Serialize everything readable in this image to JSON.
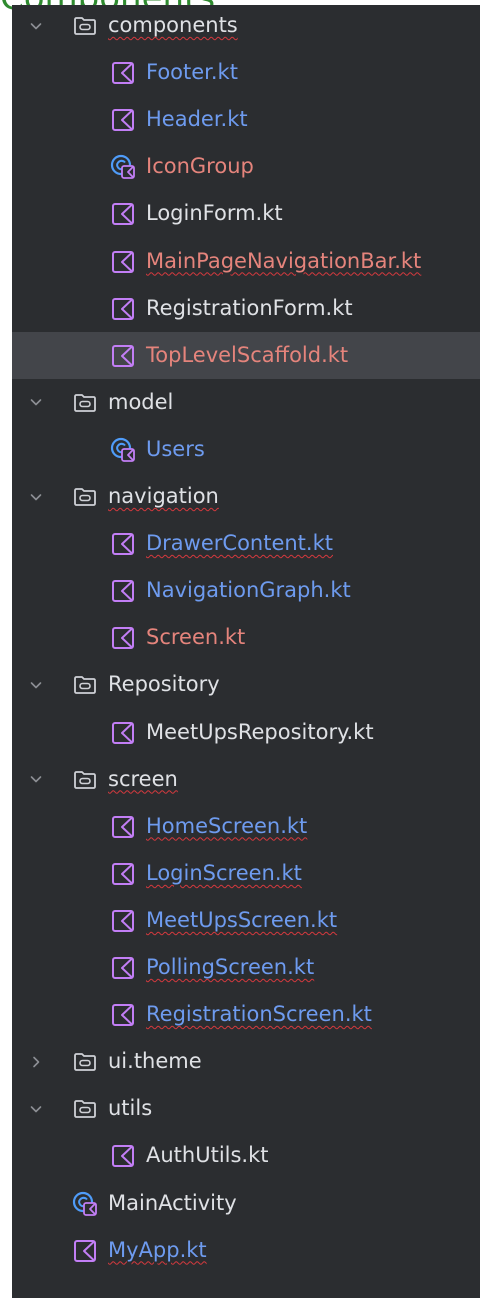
{
  "header": {
    "crop_title": "Components"
  },
  "colors": {
    "panel_bg": "#2b2d30",
    "selected_row_bg": "#43454a",
    "text_default": "#dfe1e5",
    "text_modified": "#6e9bef",
    "text_error": "#e5847c",
    "kotlin_file_icon": "#c27ef5",
    "kotlin_class_icon": "#4f9cf9",
    "squiggle": "#d5393e"
  },
  "tree": [
    {
      "name": "components",
      "kind": "folder",
      "expanded": true,
      "depth": 0,
      "color": "plain",
      "squiggle": true
    },
    {
      "name": "Footer.kt",
      "kind": "file",
      "depth": 1,
      "color": "modified",
      "squiggle": false
    },
    {
      "name": "Header.kt",
      "kind": "file",
      "depth": 1,
      "color": "modified",
      "squiggle": false
    },
    {
      "name": "IconGroup",
      "kind": "class",
      "depth": 1,
      "color": "error",
      "squiggle": false
    },
    {
      "name": "LoginForm.kt",
      "kind": "file",
      "depth": 1,
      "color": "plain",
      "squiggle": false
    },
    {
      "name": "MainPageNavigationBar.kt",
      "kind": "file",
      "depth": 1,
      "color": "error",
      "squiggle": true
    },
    {
      "name": "RegistrationForm.kt",
      "kind": "file",
      "depth": 1,
      "color": "plain",
      "squiggle": false
    },
    {
      "name": "TopLevelScaffold.kt",
      "kind": "file",
      "depth": 1,
      "color": "error",
      "squiggle": false,
      "selected": true
    },
    {
      "name": "model",
      "kind": "folder",
      "expanded": true,
      "depth": 0,
      "color": "plain",
      "squiggle": false
    },
    {
      "name": "Users",
      "kind": "class",
      "depth": 1,
      "color": "modified",
      "squiggle": false
    },
    {
      "name": "navigation",
      "kind": "folder",
      "expanded": true,
      "depth": 0,
      "color": "plain",
      "squiggle": true
    },
    {
      "name": "DrawerContent.kt",
      "kind": "file",
      "depth": 1,
      "color": "modified",
      "squiggle": true
    },
    {
      "name": "NavigationGraph.kt",
      "kind": "file",
      "depth": 1,
      "color": "modified",
      "squiggle": false
    },
    {
      "name": "Screen.kt",
      "kind": "file",
      "depth": 1,
      "color": "error",
      "squiggle": false
    },
    {
      "name": "Repository",
      "kind": "folder",
      "expanded": true,
      "depth": 0,
      "color": "plain",
      "squiggle": false
    },
    {
      "name": "MeetUpsRepository.kt",
      "kind": "file",
      "depth": 1,
      "color": "plain",
      "squiggle": false
    },
    {
      "name": "screen",
      "kind": "folder",
      "expanded": true,
      "depth": 0,
      "color": "plain",
      "squiggle": true
    },
    {
      "name": "HomeScreen.kt",
      "kind": "file",
      "depth": 1,
      "color": "modified",
      "squiggle": true
    },
    {
      "name": "LoginScreen.kt",
      "kind": "file",
      "depth": 1,
      "color": "modified",
      "squiggle": true
    },
    {
      "name": "MeetUpsScreen.kt",
      "kind": "file",
      "depth": 1,
      "color": "modified",
      "squiggle": true
    },
    {
      "name": "PollingScreen.kt",
      "kind": "file",
      "depth": 1,
      "color": "modified",
      "squiggle": true
    },
    {
      "name": "RegistrationScreen.kt",
      "kind": "file",
      "depth": 1,
      "color": "modified",
      "squiggle": true
    },
    {
      "name": "ui.theme",
      "kind": "folder",
      "expanded": false,
      "depth": 0,
      "color": "plain",
      "squiggle": false
    },
    {
      "name": "utils",
      "kind": "folder",
      "expanded": true,
      "depth": 0,
      "color": "plain",
      "squiggle": false
    },
    {
      "name": "AuthUtils.kt",
      "kind": "file",
      "depth": 1,
      "color": "plain",
      "squiggle": false
    },
    {
      "name": "MainActivity",
      "kind": "class",
      "depth": 0,
      "color": "plain",
      "squiggle": false
    },
    {
      "name": "MyApp.kt",
      "kind": "file",
      "depth": 0,
      "color": "modified",
      "squiggle": true
    }
  ]
}
